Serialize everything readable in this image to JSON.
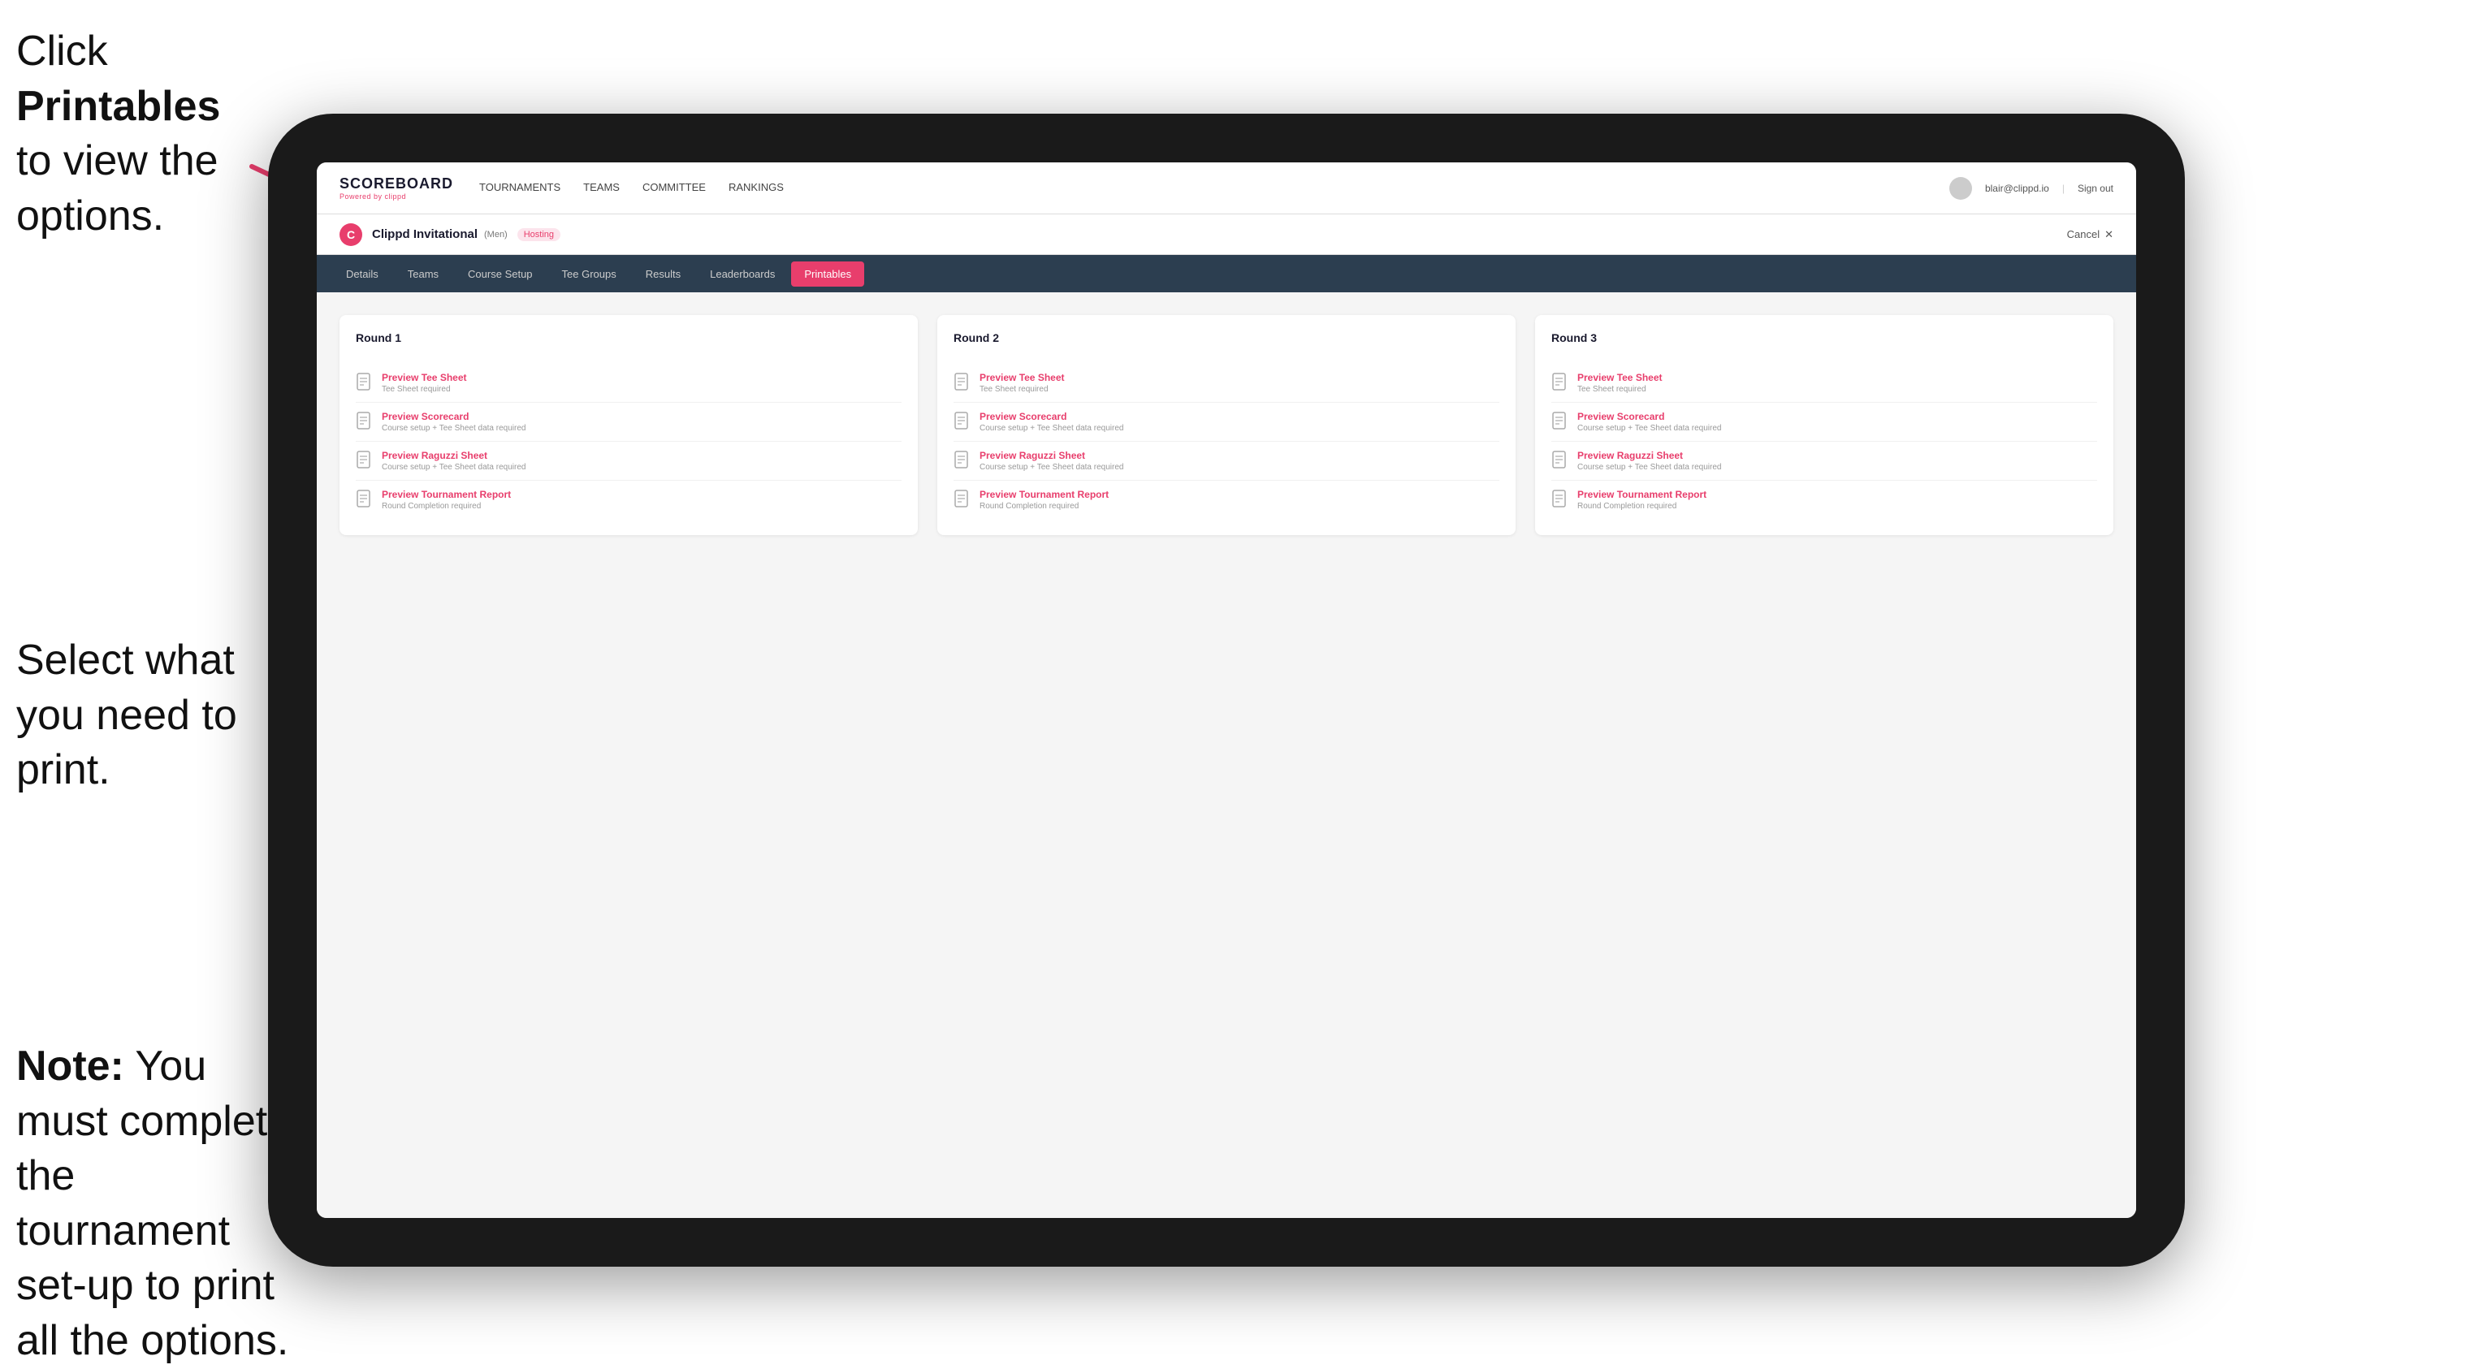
{
  "instructions": {
    "top": "Click Printables to view the options.",
    "top_bold": "Printables",
    "middle": "Select what you need to print.",
    "bottom_bold": "Note:",
    "bottom": " You must complete the tournament set-up to print all the options."
  },
  "nav": {
    "brand_title": "SCOREBOARD",
    "brand_sub": "Powered by clippd",
    "links": [
      {
        "label": "TOURNAMENTS",
        "active": false
      },
      {
        "label": "TEAMS",
        "active": false
      },
      {
        "label": "COMMITTEE",
        "active": false
      },
      {
        "label": "RANKINGS",
        "active": false
      }
    ],
    "user_email": "blair@clippd.io",
    "sign_out": "Sign out"
  },
  "tournament": {
    "logo_letter": "C",
    "name": "Clippd Invitational",
    "bracket": "(Men)",
    "hosting": "Hosting",
    "cancel": "Cancel"
  },
  "sub_tabs": [
    {
      "label": "Details",
      "active": false
    },
    {
      "label": "Teams",
      "active": false
    },
    {
      "label": "Course Setup",
      "active": false
    },
    {
      "label": "Tee Groups",
      "active": false
    },
    {
      "label": "Results",
      "active": false
    },
    {
      "label": "Leaderboards",
      "active": false
    },
    {
      "label": "Printables",
      "active": true
    }
  ],
  "rounds": [
    {
      "title": "Round 1",
      "items": [
        {
          "name": "Preview Tee Sheet",
          "req": "Tee Sheet required"
        },
        {
          "name": "Preview Scorecard",
          "req": "Course setup + Tee Sheet data required"
        },
        {
          "name": "Preview Raguzzi Sheet",
          "req": "Course setup + Tee Sheet data required"
        },
        {
          "name": "Preview Tournament Report",
          "req": "Round Completion required"
        }
      ]
    },
    {
      "title": "Round 2",
      "items": [
        {
          "name": "Preview Tee Sheet",
          "req": "Tee Sheet required"
        },
        {
          "name": "Preview Scorecard",
          "req": "Course setup + Tee Sheet data required"
        },
        {
          "name": "Preview Raguzzi Sheet",
          "req": "Course setup + Tee Sheet data required"
        },
        {
          "name": "Preview Tournament Report",
          "req": "Round Completion required"
        }
      ]
    },
    {
      "title": "Round 3",
      "items": [
        {
          "name": "Preview Tee Sheet",
          "req": "Tee Sheet required"
        },
        {
          "name": "Preview Scorecard",
          "req": "Course setup + Tee Sheet data required"
        },
        {
          "name": "Preview Raguzzi Sheet",
          "req": "Course setup + Tee Sheet data required"
        },
        {
          "name": "Preview Tournament Report",
          "req": "Round Completion required"
        }
      ]
    }
  ]
}
